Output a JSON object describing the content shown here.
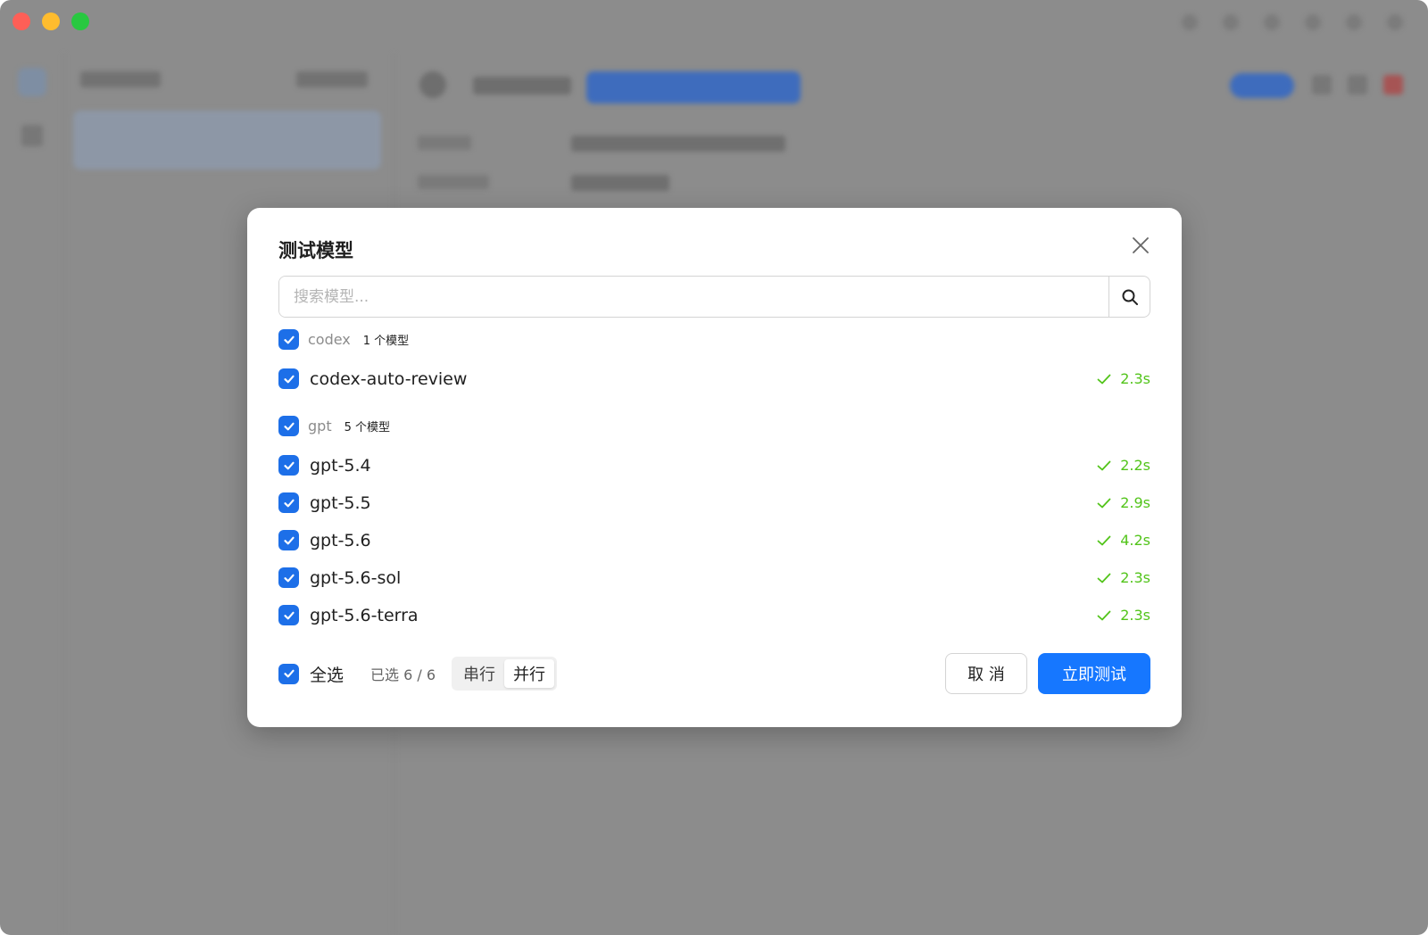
{
  "modal": {
    "title": "测试模型",
    "search_placeholder": "搜索模型...",
    "groups": [
      {
        "name": "codex",
        "count": "1 个模型",
        "models": [
          {
            "name": "codex-auto-review",
            "time": "2.3s"
          }
        ]
      },
      {
        "name": "gpt",
        "count": "5 个模型",
        "models": [
          {
            "name": "gpt-5.4",
            "time": "2.2s"
          },
          {
            "name": "gpt-5.5",
            "time": "2.9s"
          },
          {
            "name": "gpt-5.6",
            "time": "4.2s"
          },
          {
            "name": "gpt-5.6-sol",
            "time": "2.3s"
          },
          {
            "name": "gpt-5.6-terra",
            "time": "2.3s"
          }
        ]
      }
    ],
    "footer": {
      "select_all": "全选",
      "selected": "已选 6 / 6",
      "mode_serial": "串行",
      "mode_parallel": "并行",
      "cancel": "取 消",
      "run": "立即测试"
    }
  },
  "colors": {
    "accent": "#1677ff",
    "checkbox": "#1d6fe8",
    "success": "#52c41a"
  }
}
